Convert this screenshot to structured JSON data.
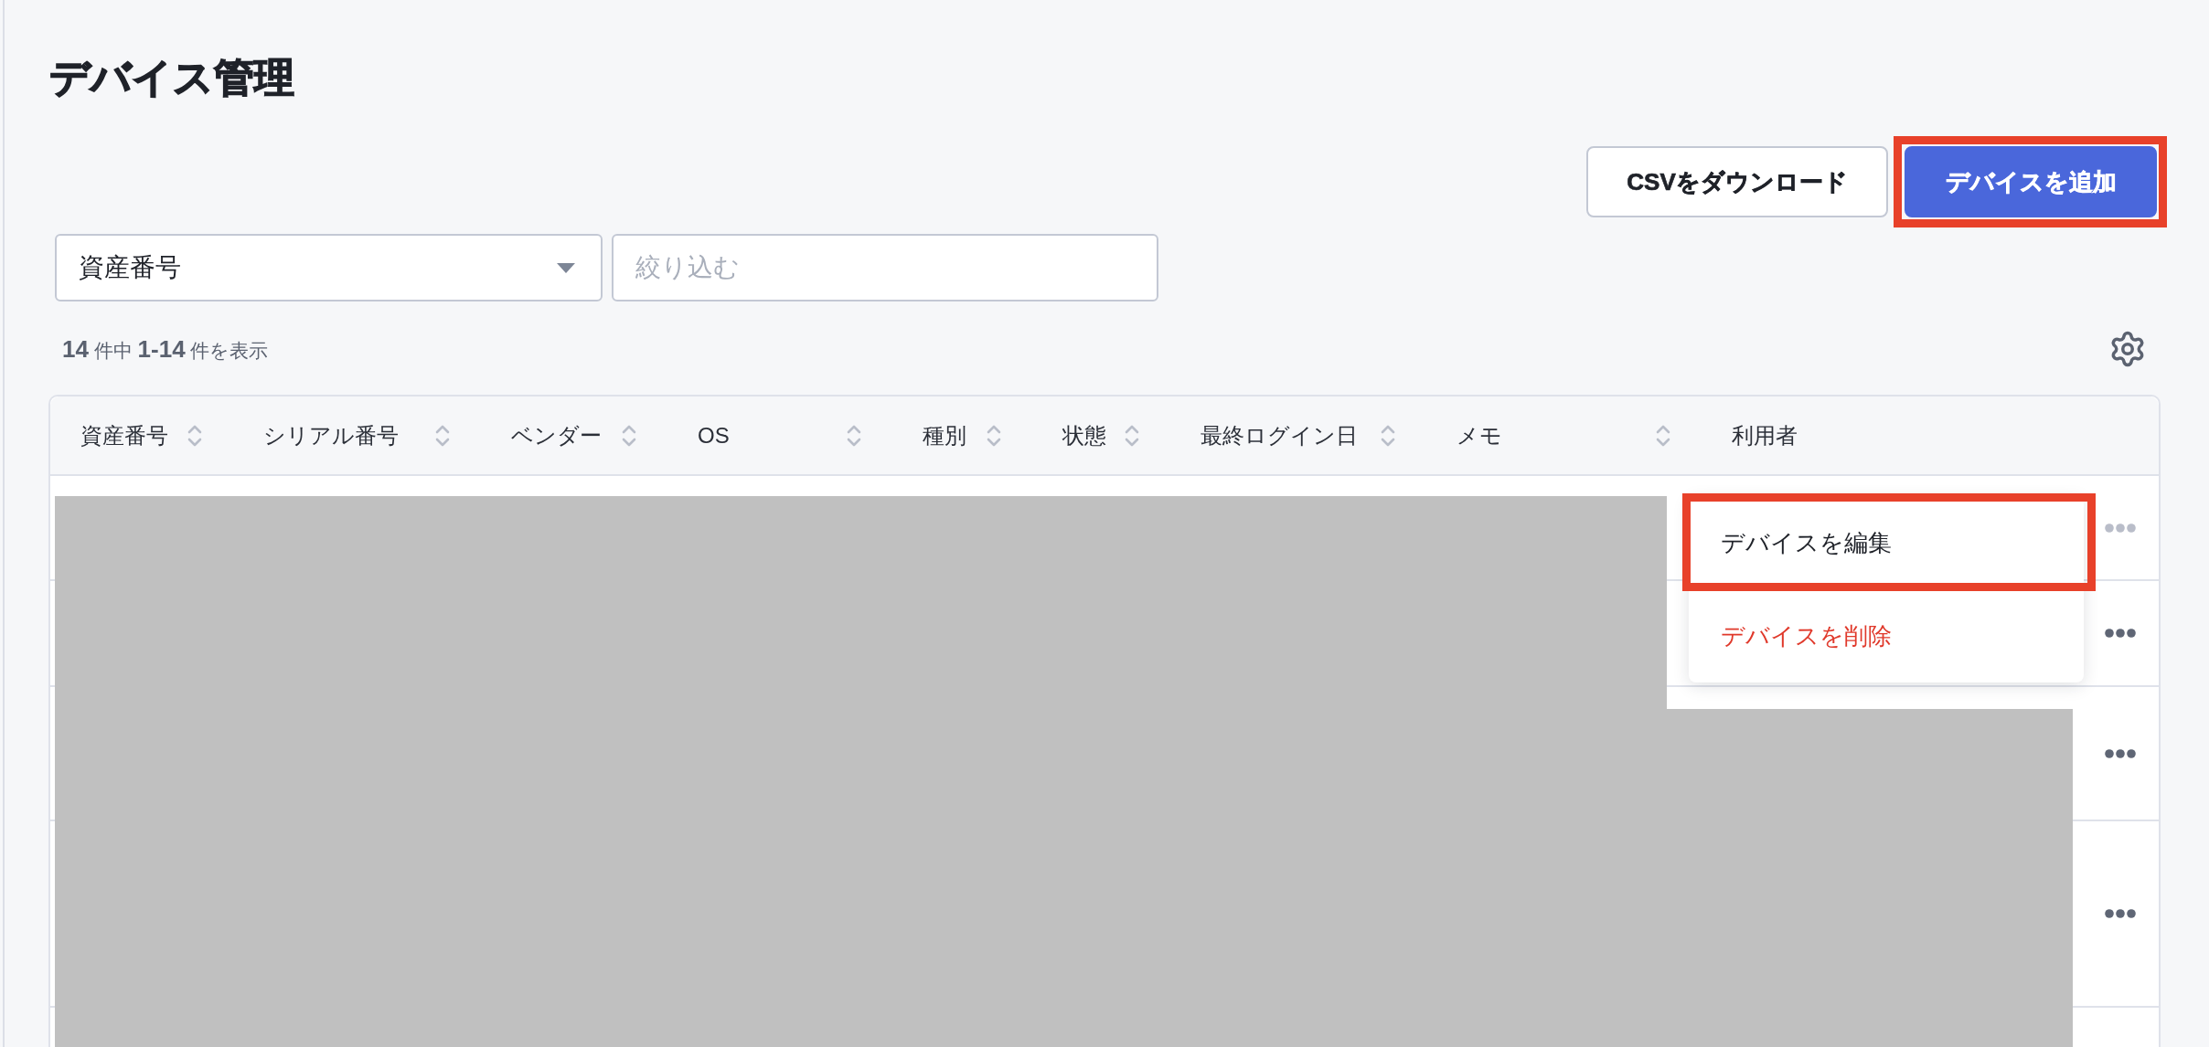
{
  "page": {
    "title": "デバイス管理"
  },
  "toolbar": {
    "buttons": [
      {
        "label": "CSVをダウンロード",
        "kind": "secondary",
        "highlighted": false
      },
      {
        "label": "デバイスを追加",
        "kind": "primary",
        "highlighted": true
      }
    ]
  },
  "filters": {
    "field_select": {
      "value": "資産番号"
    },
    "search": {
      "placeholder": "絞り込む"
    }
  },
  "result_count": "**14** 件中 **1-14** 件を表示",
  "table": {
    "columns": [
      {
        "label": "資産番号",
        "sortable": true
      },
      {
        "label": "シリアル番号",
        "sortable": true
      },
      {
        "label": "ベンダー",
        "sortable": true
      },
      {
        "label": "OS",
        "sortable": true
      },
      {
        "label": "種別",
        "sortable": true
      },
      {
        "label": "状態",
        "sortable": true
      },
      {
        "label": "最終ログイン日",
        "sortable": true
      },
      {
        "label": "メモ",
        "sortable": true
      },
      {
        "label": "利用者",
        "sortable": false
      }
    ],
    "rows": [
      {
        "menu_open": true
      },
      {
        "menu_open": false
      },
      {
        "menu_open": false
      },
      {
        "menu_open": false
      }
    ]
  },
  "row_menu": {
    "items": [
      {
        "label": "デバイスを編集",
        "kind": "normal",
        "highlighted": true
      },
      {
        "label": "デバイスを削除",
        "kind": "danger",
        "highlighted": false
      }
    ]
  }
}
